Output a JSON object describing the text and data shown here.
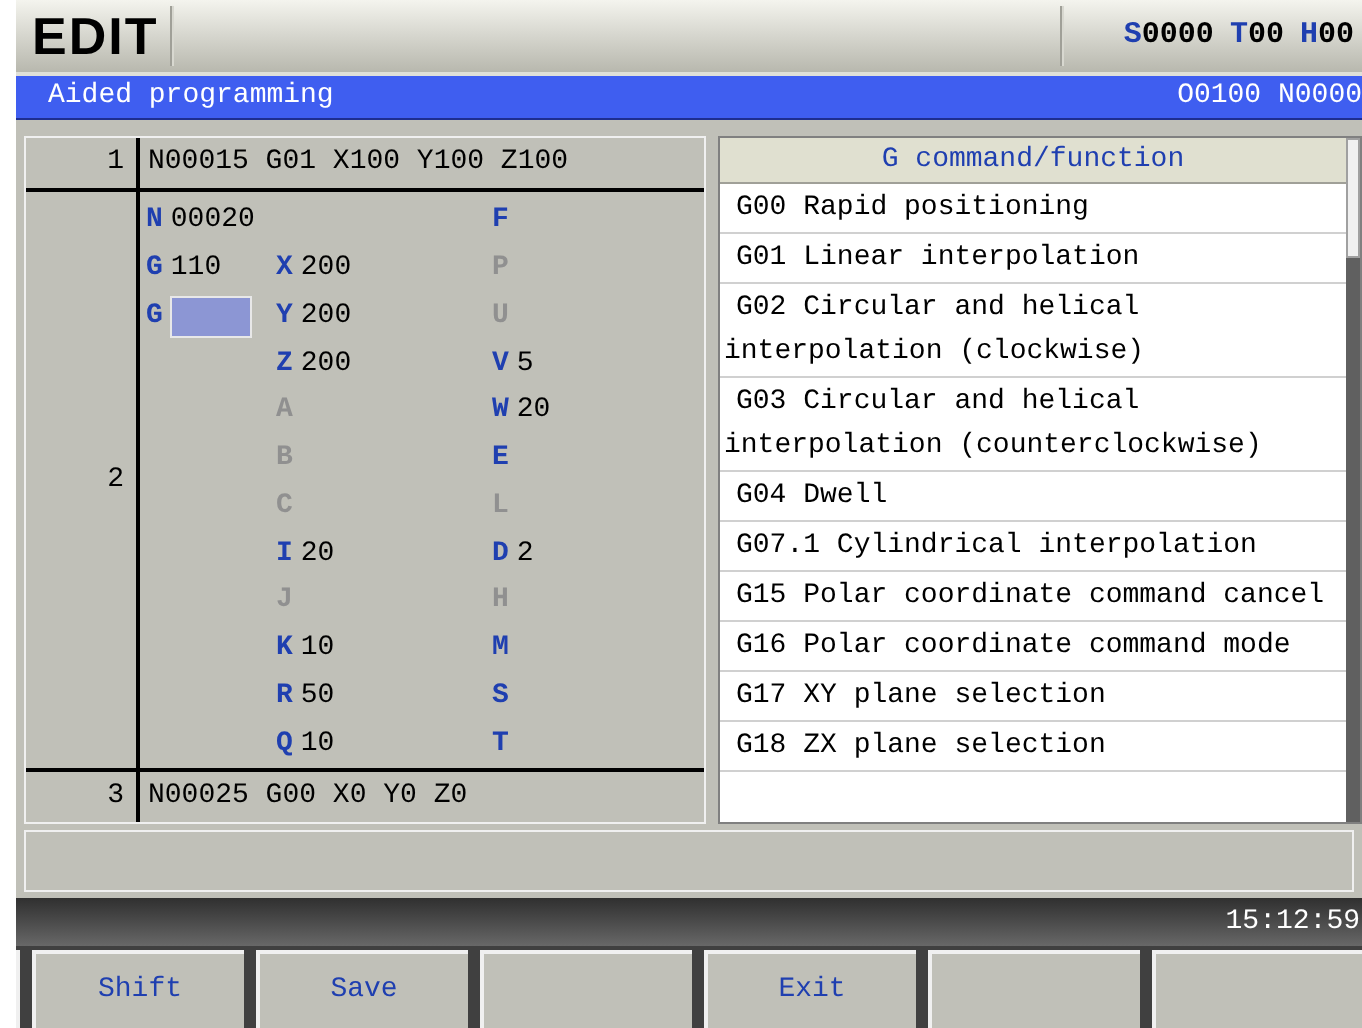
{
  "mode": "EDIT",
  "spindle_status": [
    {
      "letter": "S",
      "value": "0000"
    },
    {
      "letter": "T",
      "value": "00"
    },
    {
      "letter": "H",
      "value": "00"
    }
  ],
  "title_bar": {
    "title": "Aided programming",
    "program": "O0100 N0000"
  },
  "blocks": [
    {
      "number": "1",
      "kind": "line",
      "text": "N00015 G01 X100 Y100 Z100"
    },
    {
      "number": "2",
      "kind": "form",
      "rows": [
        {
          "cells": [
            {
              "kind": "field",
              "address": "N",
              "value": "00020",
              "enabled": true
            },
            {
              "kind": "empty"
            },
            {
              "kind": "field",
              "address": "F",
              "enabled": true
            }
          ]
        },
        {
          "cells": [
            {
              "kind": "field",
              "address": "G",
              "value": "110",
              "enabled": true
            },
            {
              "kind": "field",
              "address": "X",
              "value": "200",
              "enabled": true
            },
            {
              "kind": "field",
              "address": "P",
              "enabled": false
            }
          ]
        },
        {
          "cells": [
            {
              "kind": "input",
              "address": "G",
              "focused": true
            },
            {
              "kind": "field",
              "address": "Y",
              "value": "200",
              "enabled": true
            },
            {
              "kind": "field",
              "address": "U",
              "enabled": false
            }
          ]
        },
        {
          "cells": [
            {
              "kind": "empty"
            },
            {
              "kind": "field",
              "address": "Z",
              "value": "200",
              "enabled": true
            },
            {
              "kind": "field",
              "address": "V",
              "value": "5",
              "enabled": true
            }
          ]
        },
        {
          "cells": [
            {
              "kind": "empty"
            },
            {
              "kind": "field",
              "address": "A",
              "enabled": false
            },
            {
              "kind": "field",
              "address": "W",
              "value": "20",
              "enabled": true
            }
          ]
        },
        {
          "cells": [
            {
              "kind": "empty"
            },
            {
              "kind": "field",
              "address": "B",
              "enabled": false
            },
            {
              "kind": "field",
              "address": "E",
              "enabled": true
            }
          ]
        },
        {
          "cells": [
            {
              "kind": "empty"
            },
            {
              "kind": "field",
              "address": "C",
              "enabled": false
            },
            {
              "kind": "field",
              "address": "L",
              "enabled": false
            }
          ]
        },
        {
          "cells": [
            {
              "kind": "empty"
            },
            {
              "kind": "field",
              "address": "I",
              "value": "20",
              "enabled": true
            },
            {
              "kind": "field",
              "address": "D",
              "value": "2",
              "enabled": true
            }
          ]
        },
        {
          "cells": [
            {
              "kind": "empty"
            },
            {
              "kind": "field",
              "address": "J",
              "enabled": false
            },
            {
              "kind": "field",
              "address": "H",
              "enabled": false
            }
          ]
        },
        {
          "cells": [
            {
              "kind": "empty"
            },
            {
              "kind": "field",
              "address": "K",
              "value": "10",
              "enabled": true
            },
            {
              "kind": "field",
              "address": "M",
              "enabled": true
            }
          ]
        },
        {
          "cells": [
            {
              "kind": "empty"
            },
            {
              "kind": "field",
              "address": "R",
              "value": "50",
              "enabled": true
            },
            {
              "kind": "field",
              "address": "S",
              "enabled": true
            }
          ]
        },
        {
          "cells": [
            {
              "kind": "empty"
            },
            {
              "kind": "field",
              "address": "Q",
              "value": "10",
              "enabled": true
            },
            {
              "kind": "field",
              "address": "T",
              "enabled": true
            }
          ]
        }
      ]
    },
    {
      "number": "3",
      "kind": "line",
      "text": "N00025 G00 X0 Y0 Z0"
    }
  ],
  "command_list": {
    "header": "G command/function",
    "items": [
      {
        "code": "G00",
        "text": "Rapid positioning"
      },
      {
        "code": "G01",
        "text": "Linear interpolation"
      },
      {
        "code": "G02",
        "text": "Circular and helical",
        "continuation": "interpolation (clockwise)"
      },
      {
        "code": "G03",
        "text": "Circular and helical",
        "continuation": "interpolation (counterclockwise)"
      },
      {
        "code": "G04",
        "text": "Dwell"
      },
      {
        "code": "G07.1",
        "text": "Cylindrical interpolation"
      },
      {
        "code": "G15",
        "text": "Polar coordinate command cancel"
      },
      {
        "code": "G16",
        "text": "Polar coordinate command mode"
      },
      {
        "code": "G17",
        "text": "XY plane selection"
      },
      {
        "code": "G18",
        "text": "ZX plane selection"
      }
    ]
  },
  "clock": "15:12:59",
  "softkeys": [
    {
      "kind": "blank"
    },
    {
      "kind": "labeled",
      "label": "Shift"
    },
    {
      "kind": "labeled",
      "label": "Save"
    },
    {
      "kind": "blank"
    },
    {
      "kind": "labeled",
      "label": "Exit"
    },
    {
      "kind": "blank"
    },
    {
      "kind": "blank"
    }
  ]
}
